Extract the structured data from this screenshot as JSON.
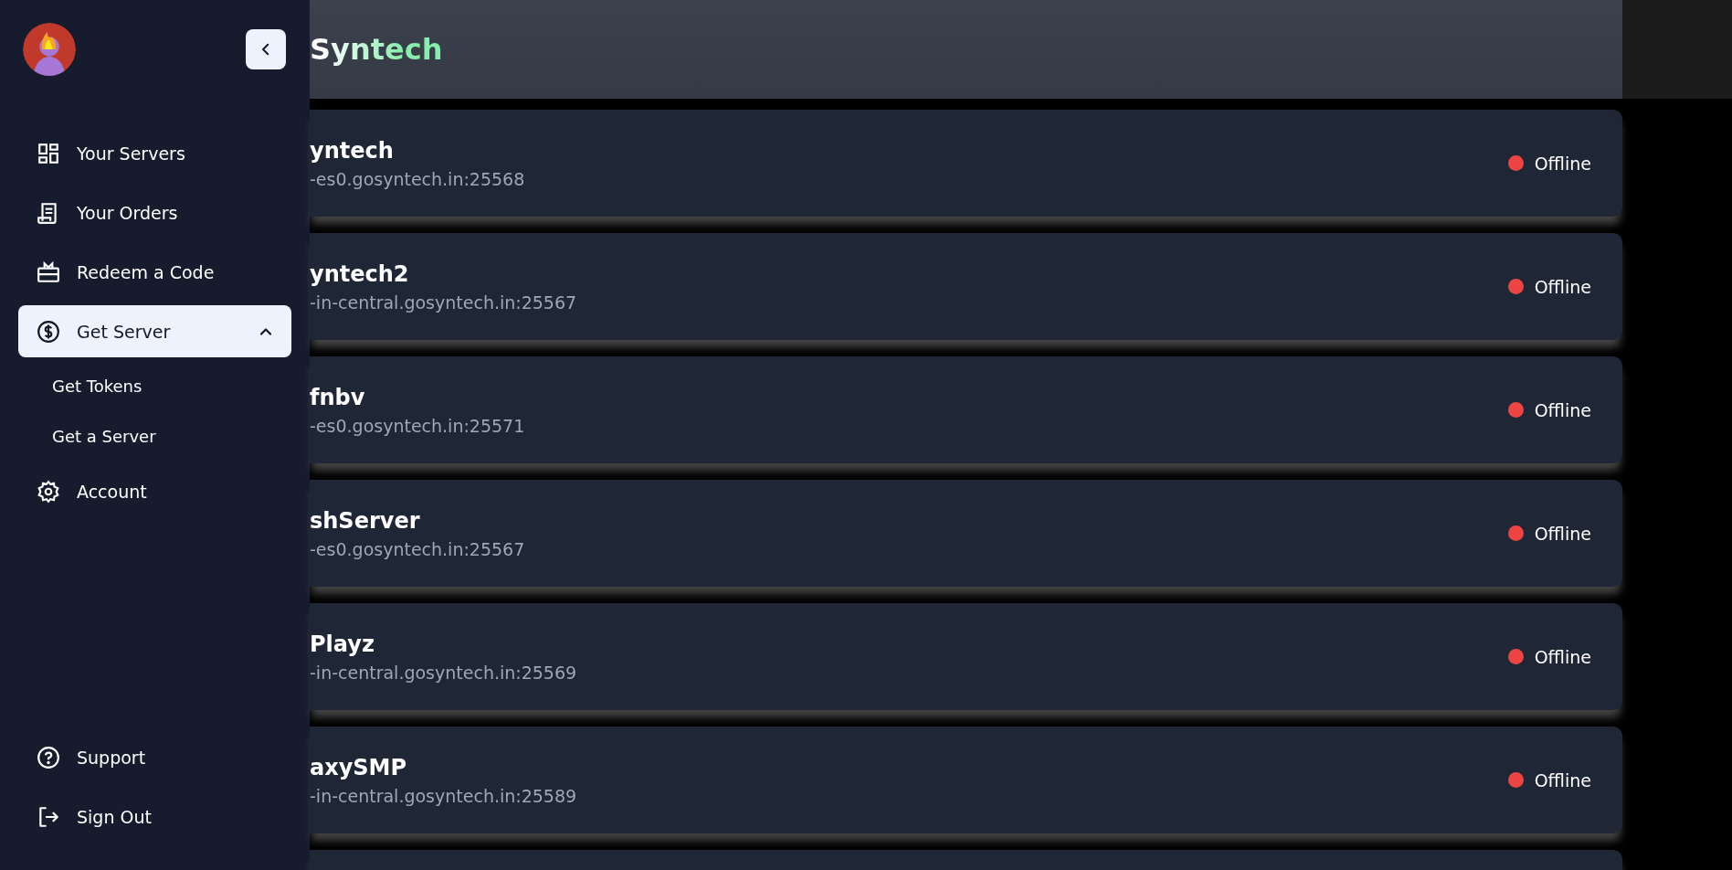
{
  "header": {
    "brand": "Syntech"
  },
  "sidebar": {
    "items": [
      {
        "label": "Your Servers",
        "selected": false
      },
      {
        "label": "Your Orders",
        "selected": false
      },
      {
        "label": "Redeem a Code",
        "selected": false
      },
      {
        "label": "Get Server",
        "selected": true,
        "expanded": true,
        "children": [
          {
            "label": "Get Tokens"
          },
          {
            "label": "Get a Server"
          }
        ]
      },
      {
        "label": "Account",
        "selected": false
      }
    ],
    "footer_items": [
      {
        "label": "Support"
      },
      {
        "label": "Sign Out"
      }
    ]
  },
  "servers": [
    {
      "name": "yntech",
      "address": "-es0.gosyntech.in:25568",
      "status": "Offline",
      "color": "#ef4444"
    },
    {
      "name": "yntech2",
      "address": "-in-central.gosyntech.in:25567",
      "status": "Offline",
      "color": "#ef4444"
    },
    {
      "name": "fnbv",
      "address": "-es0.gosyntech.in:25571",
      "status": "Offline",
      "color": "#ef4444"
    },
    {
      "name": "shServer",
      "address": "-es0.gosyntech.in:25567",
      "status": "Offline",
      "color": "#ef4444"
    },
    {
      "name": "Playz",
      "address": "-in-central.gosyntech.in:25569",
      "status": "Offline",
      "color": "#ef4444"
    },
    {
      "name": "axySMP",
      "address": "-in-central.gosyntech.in:25589",
      "status": "Offline",
      "color": "#ef4444"
    }
  ]
}
